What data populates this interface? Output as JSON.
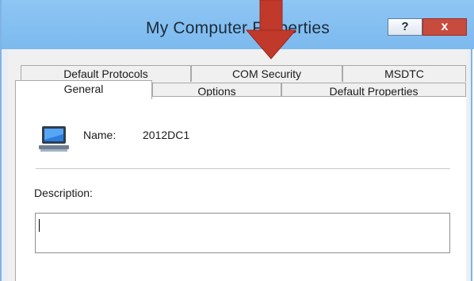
{
  "window": {
    "title": "My Computer Properties",
    "help_label": "?",
    "close_label": "x"
  },
  "tabs_back_row": [
    {
      "label": "Default Protocols"
    },
    {
      "label": "COM Security"
    },
    {
      "label": "MSDTC"
    }
  ],
  "tabs_front_row": [
    {
      "label": "General",
      "selected": true
    },
    {
      "label": "Options"
    },
    {
      "label": "Default Properties"
    }
  ],
  "general": {
    "name_label": "Name:",
    "name_value": "2012DC1",
    "description_label": "Description:",
    "description_value": ""
  },
  "icons": {
    "computer": "computer-monitor-icon",
    "annotation": "red-down-arrow-icon"
  },
  "colors": {
    "titlebar": "#7cb9ee",
    "close_button": "#c84c3e",
    "annotation_arrow": "#c0392b"
  }
}
